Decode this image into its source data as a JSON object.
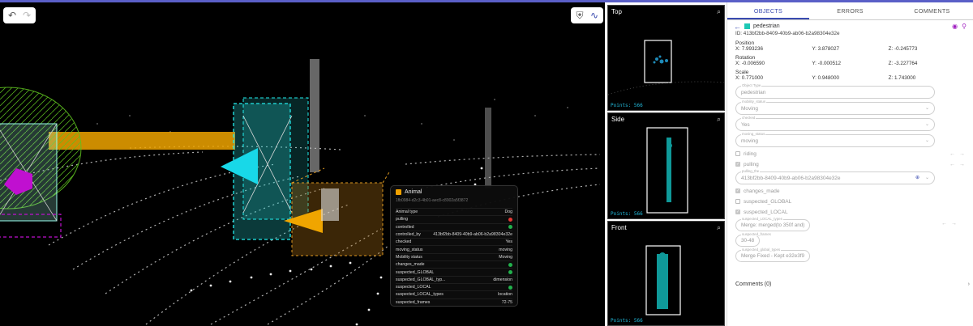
{
  "toolbar": {
    "undo_icon": "undo-icon",
    "redo_icon": "redo-icon",
    "shield_icon": "shield-icon",
    "chart_icon": "trend-icon"
  },
  "popup": {
    "title": "Animal",
    "id": "1fb0984-d2c3-4b01-aec8-c8902a5f3872",
    "rows": [
      {
        "k": "Animal type",
        "v": "Dog"
      },
      {
        "k": "pulling",
        "dot": "red"
      },
      {
        "k": "controlled",
        "dot": "green"
      },
      {
        "k": "controlled_by",
        "v": "413bf2bb-8409-40b9-ab06-b2a98304e32e"
      },
      {
        "k": "checked",
        "v": "Yes"
      },
      {
        "k": "moving_status",
        "v": "moving"
      },
      {
        "k": "Mobility status",
        "v": "Moving"
      },
      {
        "k": "changes_made",
        "dot": "green"
      },
      {
        "k": "suspected_GLOBAL",
        "dot": "green"
      },
      {
        "k": "suspected_GLOBAL_typ...",
        "v": "dimension"
      },
      {
        "k": "suspected_LOCAL",
        "dot": "green"
      },
      {
        "k": "suspected_LOCAL_types",
        "v": "location"
      },
      {
        "k": "suspected_frames",
        "v": "72-75"
      }
    ]
  },
  "views": {
    "top": {
      "label": "Top",
      "points": "Points: 566"
    },
    "side": {
      "label": "Side",
      "points": "Points: 566"
    },
    "front": {
      "label": "Front",
      "points": "Points: 566"
    }
  },
  "panel": {
    "tabs": [
      "OBJECTS",
      "ERRORS",
      "COMMENTS"
    ],
    "object_name": "pedestrian",
    "id_line": "ID: 413bf2bb-8409-40b9-ab06-b2a98304e32e",
    "position_label": "Position",
    "position": {
      "x": "X: 7.993236",
      "y": "Y: 3.878027",
      "z": "Z: -0.245773"
    },
    "rotation_label": "Rotation",
    "rotation": {
      "x": "X: -0.006590",
      "y": "Y: -0.000512",
      "z": "Z: -3.227764"
    },
    "scale_label": "Scale",
    "scale": {
      "x": "X: 0.771000",
      "y": "Y: 0.948000",
      "z": "Z: 1.743000"
    },
    "fields": {
      "object_type": {
        "label": "Object Type",
        "value": "pedestrian"
      },
      "mobility": {
        "label": "mobility_status",
        "value": "Moving"
      },
      "checked": {
        "label": "checked",
        "value": "Yes"
      },
      "moving_status": {
        "label": "moving_status",
        "value": "moving"
      },
      "pulling_the": {
        "label": "pulling_the",
        "value": "413bf2bb-8409-40b9-ab06-b2a98304e32e"
      }
    },
    "checks": {
      "riding": "riding",
      "pulling": "pulling",
      "changes_made": "changes_made",
      "suspected_global": "suspected_GLOBAL",
      "suspected_local": "suspected_LOCAL"
    },
    "pills": {
      "local_types": {
        "label": "suspected_LOCAL_types",
        "value": "Merge: merged(to 350f and)"
      },
      "frames": {
        "label": "suspected_frames",
        "value": "30-48"
      },
      "global_types": {
        "label": "suspected_global_types",
        "value": "Merge Fixed - Kept e32e3f9"
      }
    },
    "comments": "Comments (0)"
  }
}
